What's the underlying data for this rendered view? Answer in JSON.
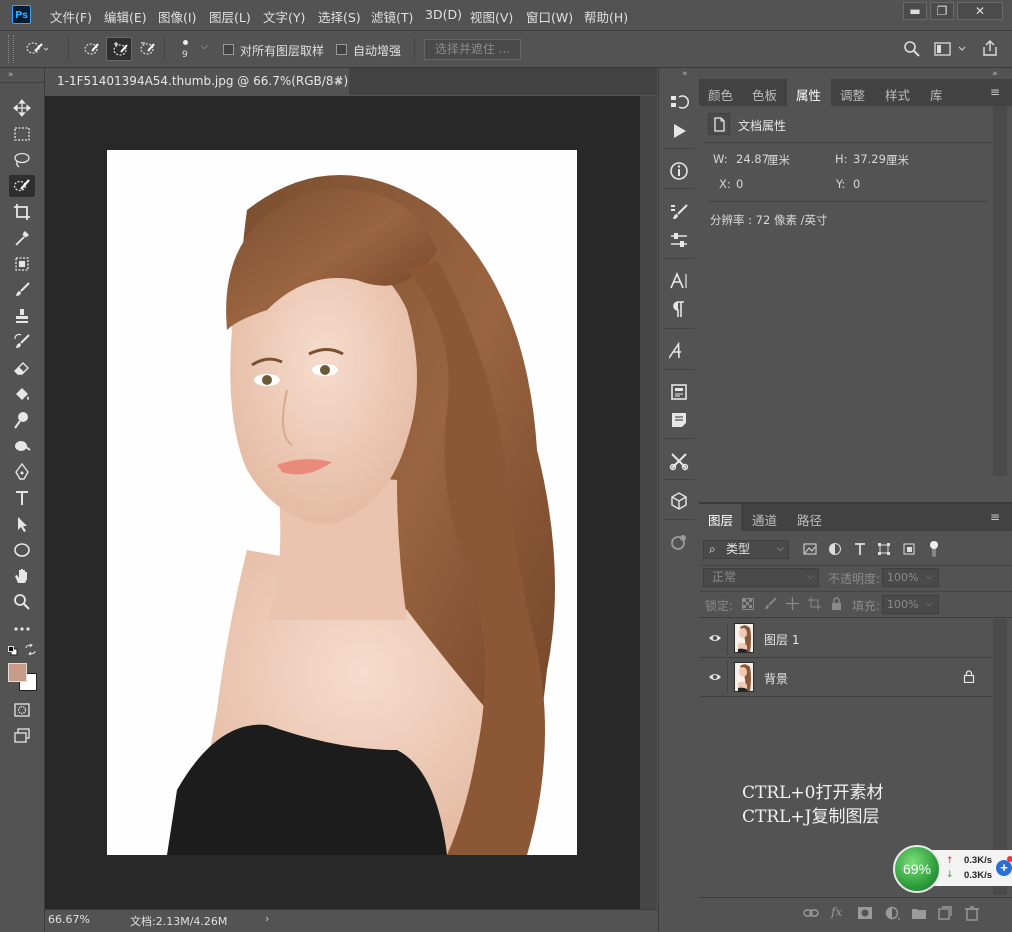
{
  "app": {
    "logo": "Ps"
  },
  "menu": [
    "文件(F)",
    "编辑(E)",
    "图像(I)",
    "图层(L)",
    "文字(Y)",
    "选择(S)",
    "滤镜(T)",
    "3D(D)",
    "视图(V)",
    "窗口(W)",
    "帮助(H)"
  ],
  "window_controls": {
    "minimize": "▬",
    "maximize": "❐",
    "close": "✕"
  },
  "options": {
    "brush_size": "9",
    "sample_all_layers": "对所有图层取样",
    "auto_enhance": "自动增强",
    "select_and_mask": "选择并遮住 ..."
  },
  "document": {
    "tab_title": "1-1F51401394A54.thumb.jpg @ 66.7%(RGB/8#) *",
    "zoom": "66.67%",
    "doc_info": "文档:2.13M/4.26M"
  },
  "colors": {
    "foreground": "#c99a86",
    "background": "#ffffff",
    "accent": "#31a8ff"
  },
  "panel_tabs_top": [
    "颜色",
    "色板",
    "属性",
    "调整",
    "样式",
    "库"
  ],
  "properties": {
    "title": "文档属性",
    "w_label": "W:",
    "w_value": "24.87",
    "w_unit": "厘米",
    "h_label": "H:",
    "h_value": "37.29",
    "h_unit": "厘米",
    "x_label": "X:",
    "x_value": "0",
    "y_label": "Y:",
    "y_value": "0",
    "resolution": "分辨率 : 72 像素 /英寸"
  },
  "panel_tabs_layers": [
    "图层",
    "通道",
    "路径"
  ],
  "layers": {
    "filter_kind": "类型",
    "blend_mode": "正常",
    "opacity_label": "不透明度:",
    "opacity_value": "100%",
    "lock_label": "锁定:",
    "fill_label": "填充:",
    "fill_value": "100%",
    "items": [
      {
        "name": "图层 1",
        "locked": false
      },
      {
        "name": "背景",
        "locked": true
      }
    ]
  },
  "annotation": {
    "line1": "CTRL+0打开素材",
    "line2": "CTRL+J复制图层"
  },
  "network": {
    "percent": "69%",
    "up": "0.3K/s",
    "down": "0.3K/s"
  }
}
